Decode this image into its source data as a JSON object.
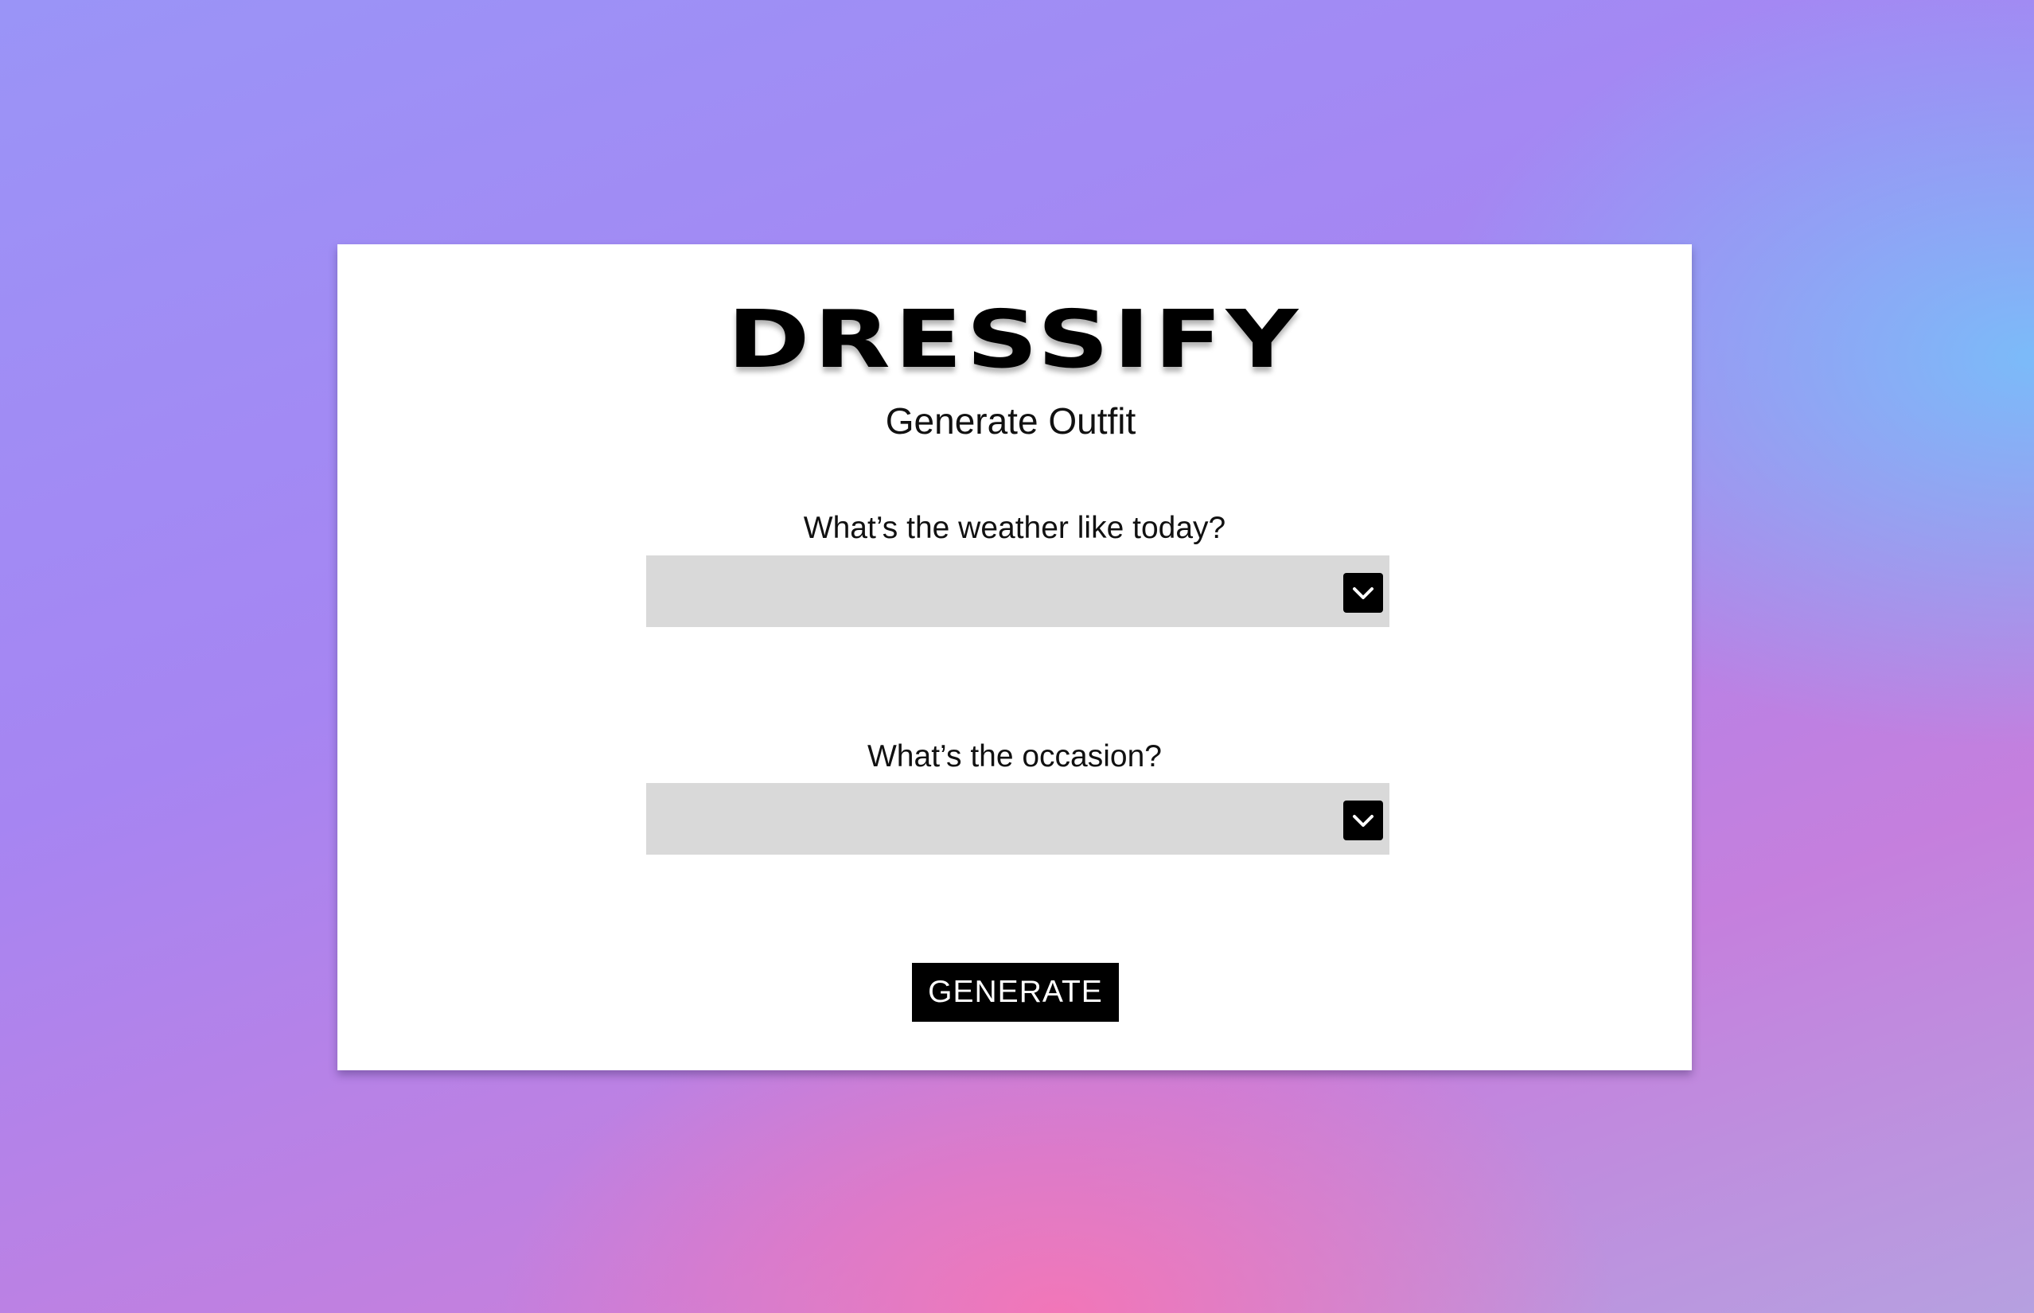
{
  "app": {
    "logo_text": "DRESSIFY",
    "subtitle": "Generate Outfit"
  },
  "form": {
    "weather": {
      "question": "What’s the weather like today?",
      "selected_value": "",
      "dropdown_icon": "chevron-down-icon"
    },
    "occasion": {
      "question": "What’s the occasion?",
      "selected_value": "",
      "dropdown_icon": "chevron-down-icon"
    },
    "generate_label": "GENERATE"
  },
  "colors": {
    "card_background": "#ffffff",
    "select_background": "#d9d9d9",
    "button_background": "#000000",
    "button_text": "#ffffff",
    "background_gradient": [
      "#9a94f7",
      "#78bef9",
      "#f276b8"
    ]
  }
}
